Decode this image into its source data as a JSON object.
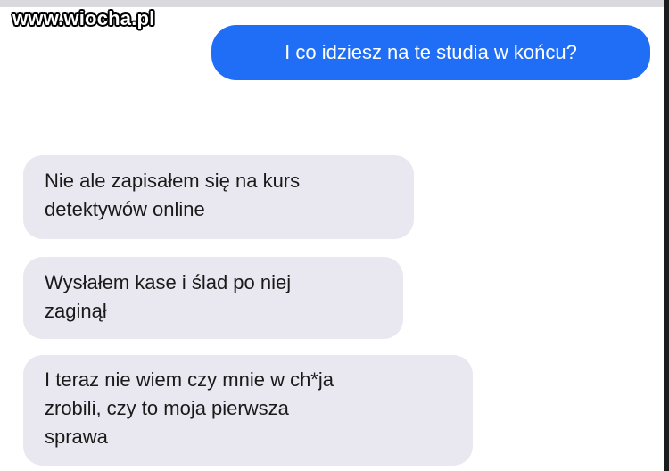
{
  "watermark": "www.wiocha.pl",
  "messages": {
    "outgoing": [
      {
        "text": "I co idziesz na te studia w końcu?"
      }
    ],
    "incoming": [
      {
        "text": "Nie ale zapisałem się na kurs\ndetektywów online"
      },
      {
        "text": "Wysłałem kase i ślad po niej\nzaginął"
      },
      {
        "text": "I teraz nie wiem czy mnie w ch*ja\nzrobili, czy to moja pierwsza\nsprawa"
      }
    ]
  },
  "colors": {
    "outgoing_bubble": "#1f6ef5",
    "incoming_bubble": "#e9e7ef",
    "background": "#ffffff"
  }
}
